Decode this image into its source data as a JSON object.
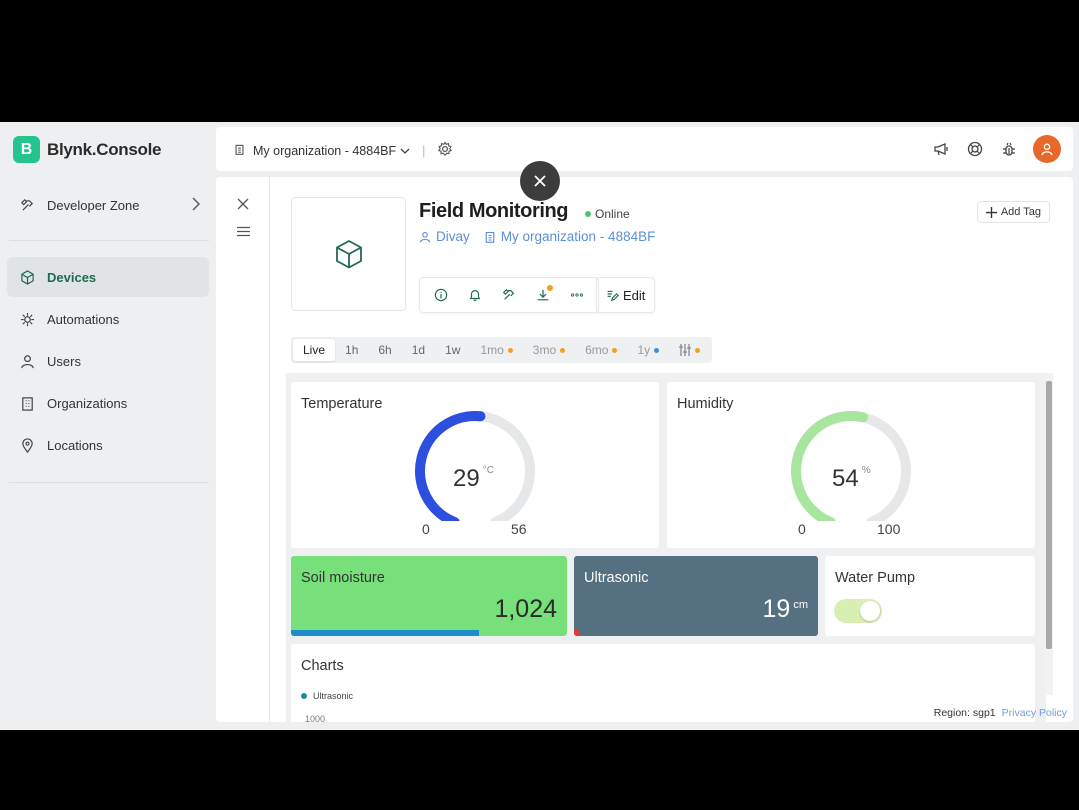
{
  "brand": {
    "logo_letter": "B",
    "name": "Blynk.Console"
  },
  "sidebar": {
    "developer_zone": "Developer Zone",
    "items": [
      {
        "label": "Devices",
        "icon": "cube-icon",
        "active": true
      },
      {
        "label": "Automations",
        "icon": "automation-icon"
      },
      {
        "label": "Users",
        "icon": "users-icon"
      },
      {
        "label": "Organizations",
        "icon": "building-icon"
      },
      {
        "label": "Locations",
        "icon": "location-pin-icon"
      }
    ]
  },
  "topbar": {
    "org_name": "My organization - 4884BF",
    "avatar_color": "#e8672b"
  },
  "device": {
    "title": "Field Monitoring",
    "status": "Online",
    "owner": "Divay",
    "organization": "My organization - 4884BF",
    "add_tag_label": "Add Tag",
    "edit_label": "Edit"
  },
  "time_ranges": [
    {
      "label": "Live",
      "active": true
    },
    {
      "label": "1h"
    },
    {
      "label": "6h"
    },
    {
      "label": "1d"
    },
    {
      "label": "1w"
    },
    {
      "label": "1mo",
      "dot": "#f0a21d"
    },
    {
      "label": "3mo",
      "dot": "#f0a21d"
    },
    {
      "label": "6mo",
      "dot": "#f0a21d"
    },
    {
      "label": "1y",
      "dot": "#3e8ede"
    }
  ],
  "widgets": {
    "temperature": {
      "title": "Temperature",
      "value": "29",
      "unit": "°C",
      "min": "0",
      "max": "56",
      "fraction": 0.518,
      "color": "#2c4fe0"
    },
    "humidity": {
      "title": "Humidity",
      "value": "54",
      "unit": "%",
      "min": "0",
      "max": "100",
      "fraction": 0.54,
      "color": "#a8e6a0"
    },
    "soil": {
      "title": "Soil moisture",
      "value": "1,024",
      "bg": "#77e07a",
      "bar_fraction": 0.68,
      "bar_color": "#1f8dc9"
    },
    "ultrasonic": {
      "title": "Ultrasonic",
      "value": "19",
      "unit": "cm",
      "bg": "#557080"
    },
    "pump": {
      "title": "Water Pump",
      "on": true
    },
    "charts": {
      "title": "Charts",
      "legend": "Ultrasonic",
      "axis_label": "1000"
    }
  },
  "footer": {
    "region": "Region: sgp1",
    "privacy": "Privacy Policy"
  }
}
